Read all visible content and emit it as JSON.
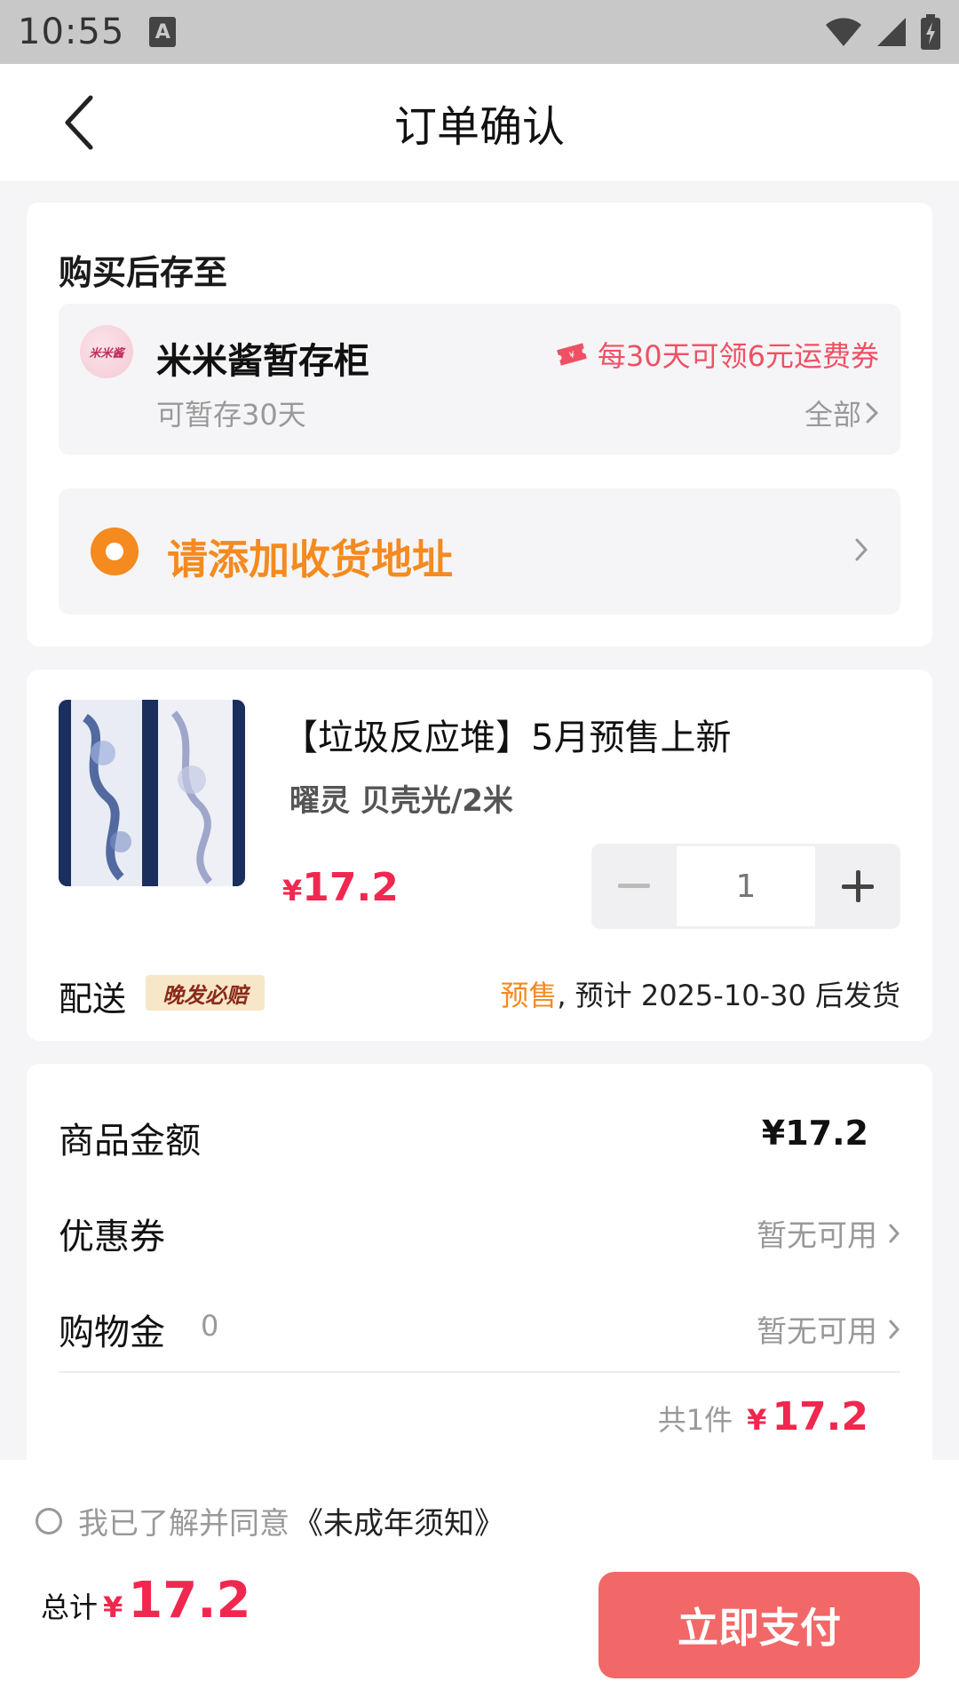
{
  "status_bar": {
    "time": "10:55",
    "input_indicator": "A"
  },
  "header": {
    "title": "订单确认"
  },
  "storage": {
    "section_title": "购买后存至",
    "locker_avatar_text": "米米酱",
    "locker_name": "米米酱暂存柜",
    "locker_sub": "可暂存30天",
    "coupon_text": "每30天可领6元运费券",
    "all_link": "全部"
  },
  "address": {
    "add_label": "请添加收货地址"
  },
  "product": {
    "title": "【垃圾反应堆】5月预售上新",
    "spec": "曜灵 贝壳光/2米",
    "price_symbol": "¥",
    "price": "17.2",
    "quantity": "1",
    "delivery_label": "配送",
    "delivery_badge": "晚发必赔",
    "presale_tag": "预售",
    "ship_note": ", 预计 2025-10-30 后发货"
  },
  "amounts": {
    "goods_label": "商品金额",
    "goods_value": "¥17.2",
    "coupon_label": "优惠券",
    "coupon_value": "暂无可用",
    "shopping_credit_label": "购物金",
    "shopping_credit_balance": "0",
    "shopping_credit_value": "暂无可用",
    "count_text": "共1件",
    "subtotal_symbol": "¥",
    "subtotal_value": "17.2"
  },
  "bottom": {
    "agree_text": "我已了解并同意",
    "agree_link": "《未成年须知》",
    "total_label": "总计",
    "total_symbol": "¥",
    "total_value": "17.2",
    "pay_label": "立即支付"
  },
  "colors": {
    "accent_red": "#f0284f",
    "accent_orange": "#f58a1f",
    "pay_button": "#f26868",
    "background": "#f5f5f7"
  }
}
